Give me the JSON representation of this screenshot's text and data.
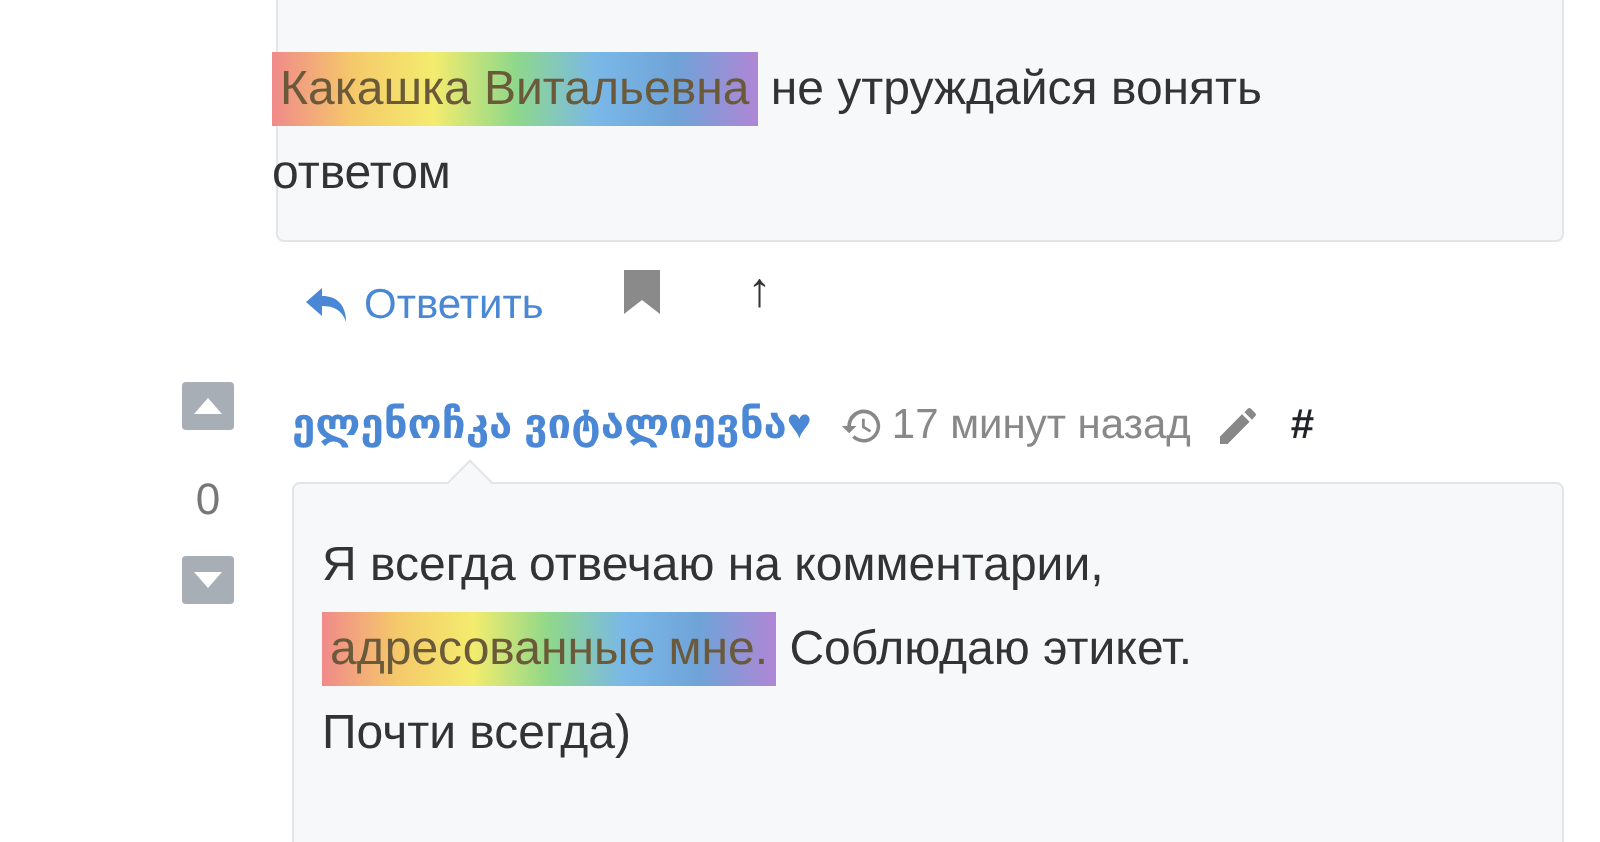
{
  "comments": [
    {
      "paragraph": [
        {
          "text": "Какашка Витальевна",
          "highlighted": true
        },
        {
          "text": " не утруждайся вонять ответом",
          "highlighted": false
        }
      ],
      "actions": {
        "reply": "Ответить",
        "up": "↑"
      }
    },
    {
      "votes": {
        "score": "0"
      },
      "author": "ელენოჩკა ვიტალიევნა♥",
      "time": "17 минут назад",
      "anchor": "#",
      "paragraph": [
        {
          "text": "Я всегда отвечаю на комментарии, ",
          "highlighted": false
        },
        {
          "text": "адресованные мне.",
          "highlighted": true
        },
        {
          "text": " Соблюдаю этикет. Почти всегда)",
          "highlighted": false
        }
      ]
    }
  ]
}
